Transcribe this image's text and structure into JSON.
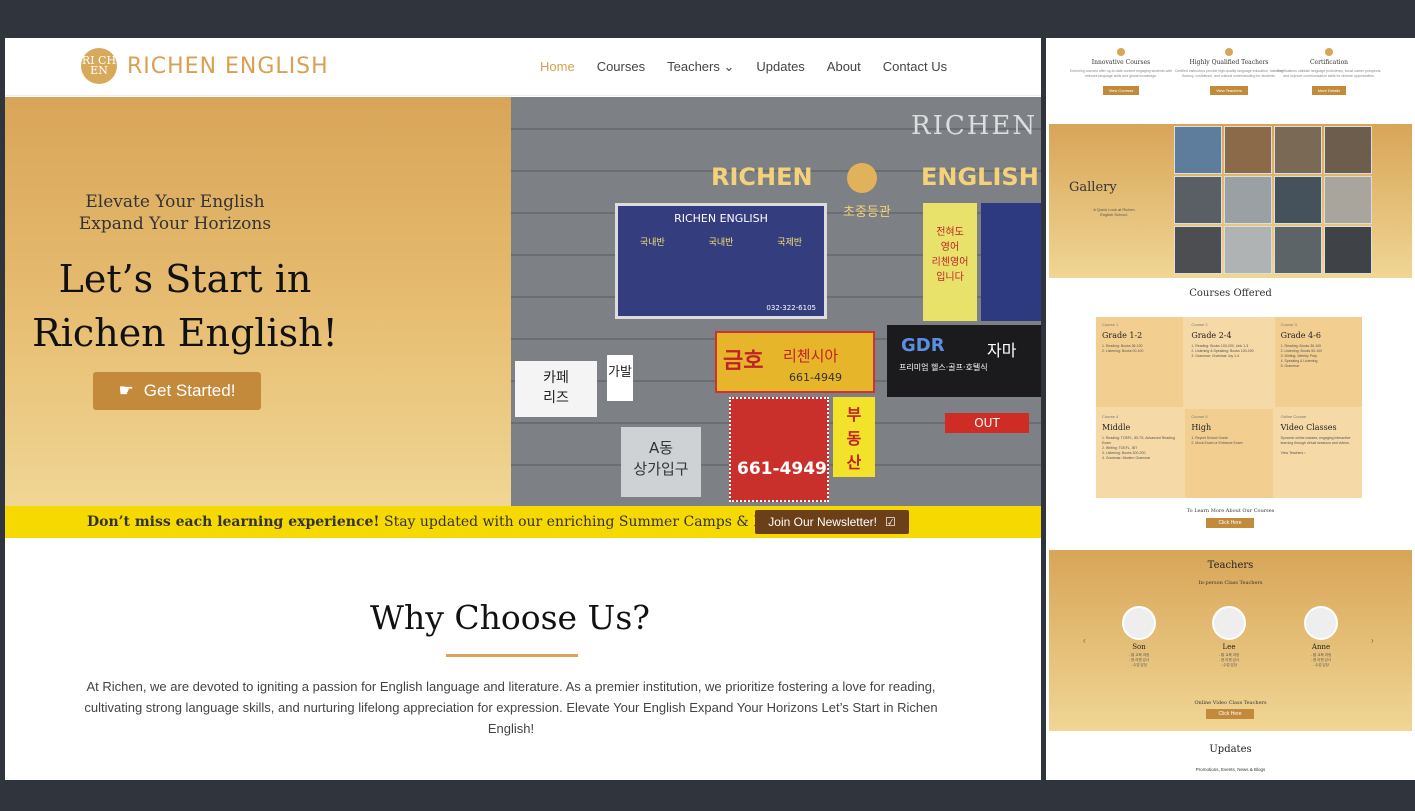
{
  "brand": {
    "name": "RICHEN ENGLISH",
    "mark": "RI CH EN"
  },
  "nav": {
    "items": [
      "Home",
      "Courses",
      "Teachers ⌄",
      "Updates",
      "About",
      "Contact Us"
    ]
  },
  "hero": {
    "tagline1": "Elevate Your English",
    "tagline2": "Expand Your Horizons",
    "headline1": "Let’s Start in",
    "headline2": "Richen English!",
    "cta_label": "Get Started!",
    "cta_icon": "hand-pointer-icon"
  },
  "photo_signs": {
    "top_watermark": "RICHEN",
    "building_left": "RICHEN",
    "building_right": "ENGLISH",
    "building_sub": "초중등관",
    "poster_title": "RICHEN ENGLISH",
    "poster_phone": "032-322-6105",
    "poster_col1": "국내반",
    "poster_col2": "국내반",
    "poster_col3": "국제반",
    "side_banner": "전혀도\n영어\n리첸영어\n입니다",
    "cafe": "카페\n리즈",
    "shop1_big": "가발",
    "shop2_title": "금호",
    "shop2_sub": "리첸시아",
    "shop2_phone": "661-4949",
    "shop2_side": "부\n동\n산",
    "gdr": "GDR",
    "gdr_kor": "자마",
    "gdr_sub": "프리미엄 헬스·골프·호텔식",
    "out": "OUT",
    "dong": "A동\n상가입구",
    "phone2": "661-4949"
  },
  "banner": {
    "bold": "Don’t miss each learning experience!",
    "rest": " Stay updated with our enriching Summer Camps & Events.",
    "button": "Join Our Newsletter!"
  },
  "why": {
    "title": "Why Choose Us?",
    "text": "At Richen, we are devoted to igniting a passion for English language and literature. As a premier institution, we prioritize fostering a love for reading, cultivating strong language skills, and nurturing lifelong appreciation for expression. Elevate Your English Expand Your Horizons Let’s Start in Richen English!"
  },
  "side": {
    "features": [
      {
        "title": "Innovative Courses",
        "desc": "Enriching courses offer up-to-date content engaging students with relevant language skills and global knowledge.",
        "button": "View Courses"
      },
      {
        "title": "Highly Qualified Teachers",
        "desc": "Certified instructors provide high-quality language education, fostering fluency, confidence, and cultural understanding for students.",
        "button": "View Teachers"
      },
      {
        "title": "Certification",
        "desc": "Certifications validate language proficiency, boost career prospects, and improve communication skills for diverse opportunities.",
        "button": "More Details"
      }
    ],
    "gallery_title": "Gallery",
    "gallery_sub": "A Quick Look at Richen English School.",
    "courses_title": "Courses Offered",
    "courses": [
      {
        "num": "Course 1",
        "name": "Grade 1-2",
        "lines": "1. Reading: Books 36-100\n2. Listening: Books 00-100"
      },
      {
        "num": "Course 2",
        "name": "Grade 2-4",
        "lines": "1. Reading: Books 100-200, Link 1-3\n2. Listening & Speaking: Books 100-200\n3. Grammar: Grammar Joy 1-4"
      },
      {
        "num": "Course 3",
        "name": "Grade 4-6",
        "lines": "1. Reading: Books 36-100\n2. Listening: Books 50-100\n3. Writing: Weekly Prep\n4. Speaking & Listening\n5. Grammar"
      },
      {
        "num": "Course 4",
        "name": "Middle",
        "lines": "1. Reading: TOEFL, IELTS, Advanced Reading Exam\n2. Writing: TOEFL, IBT\n3. Listening: Books 300-200\n4. Grammar: Modern Grammar"
      },
      {
        "num": "Course 5",
        "name": "High",
        "lines": "1. Report School Grade\n2. Mock Exam or Entrance Exam"
      },
      {
        "num": "Online Course",
        "name": "Video Classes",
        "lines": "Dynamic online classes, engaging interactive learning through virtual sessions and videos.\n\nView Teachers ›"
      }
    ],
    "learn_more": "To Learn More About Our Courses",
    "click_here": "Click Here",
    "teachers_title": "Teachers",
    "teachers_sub": "In-person Class Teachers",
    "teachers": [
      {
        "name": "Son",
        "lines": "- 前 교육 과정\n- 현 리첸 강사\n- 수업 담당"
      },
      {
        "name": "Lee",
        "lines": "- 前 교육 과정\n- 현 리첸 강사\n- 수업 담당"
      },
      {
        "name": "Anne",
        "lines": "- 前 교육 과정\n- 현 리첸 강사\n- 수업 담당"
      }
    ],
    "online_teachers": "Online Video Class Teachers",
    "online_btn": "Click Here",
    "updates_title": "Updates",
    "updates_sub": "Promotions, Events, News & Blogs"
  }
}
